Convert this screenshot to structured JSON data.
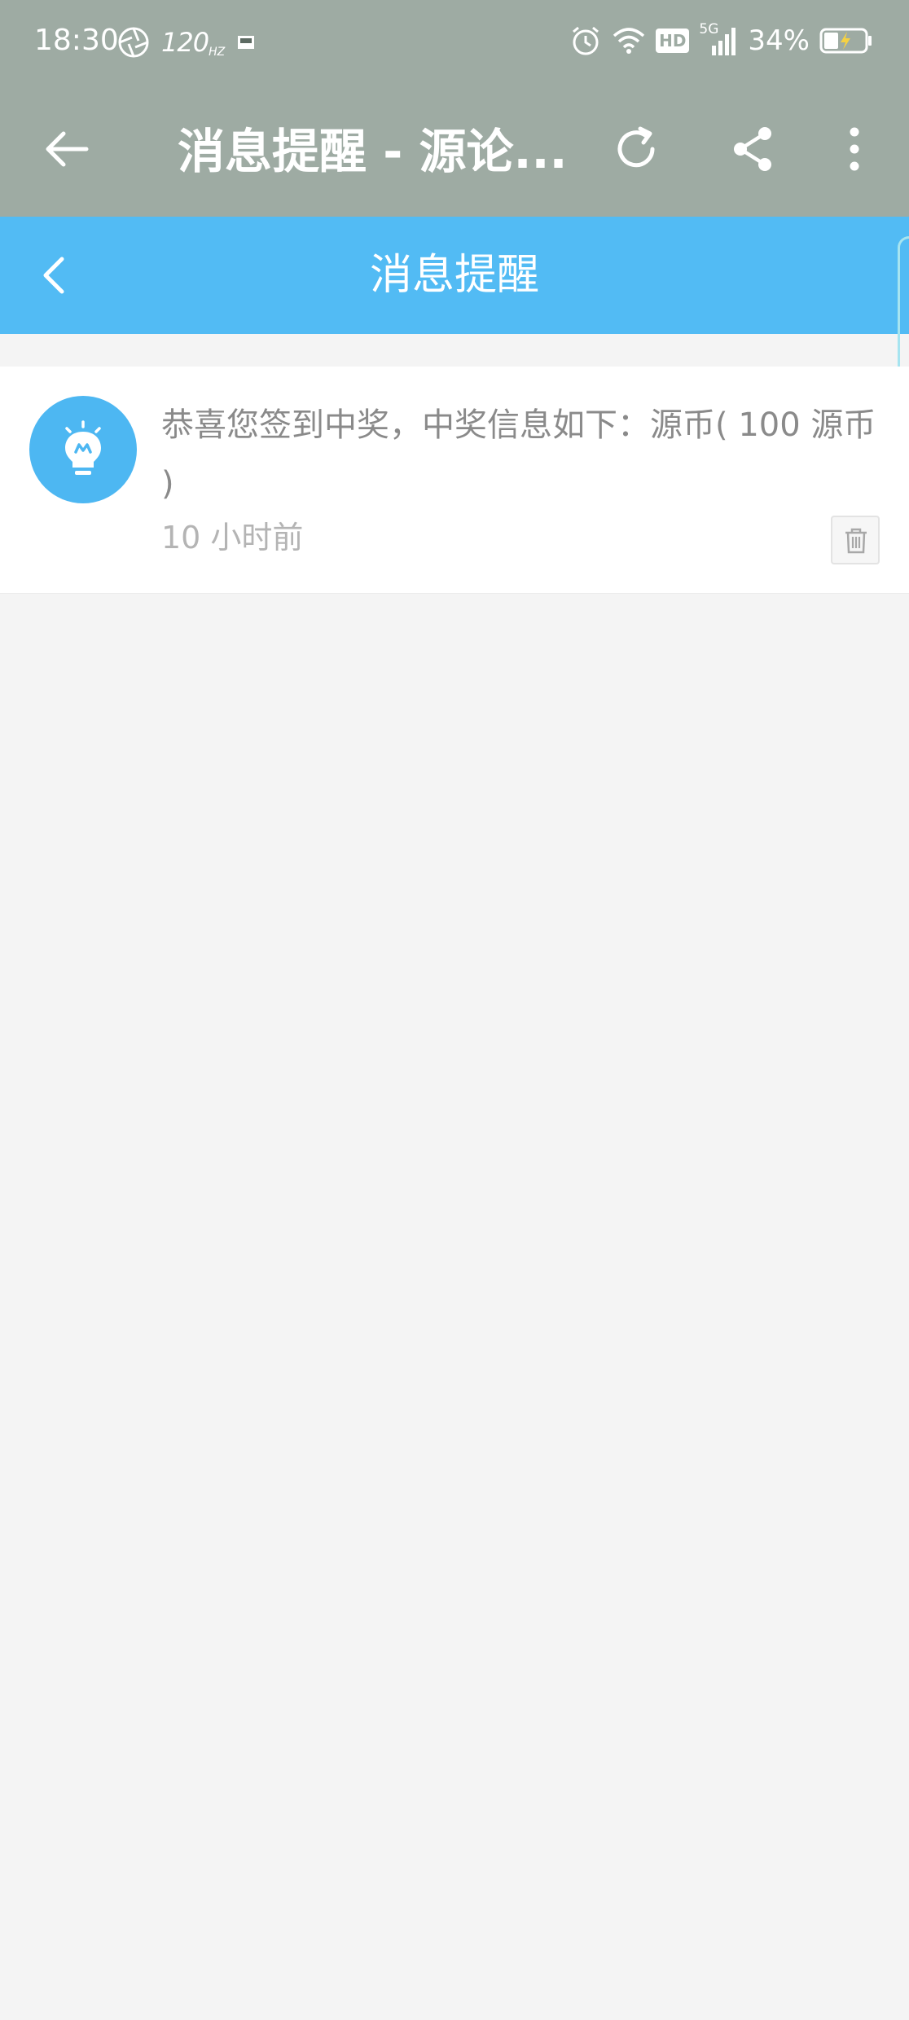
{
  "status_bar": {
    "time": "18:30",
    "refresh_rate": "120",
    "refresh_unit": "HZ",
    "network": "5G",
    "hd_badge": "HD",
    "battery": "34%",
    "icons": [
      "aperture-icon",
      "sim-icon",
      "alarm-icon",
      "wifi-icon",
      "hd-icon",
      "signal-icon",
      "battery-charging-icon"
    ]
  },
  "app_bar": {
    "title": "消息提醒 - 源论...",
    "icons": [
      "back-arrow-icon",
      "refresh-icon",
      "share-icon",
      "more-vertical-icon"
    ]
  },
  "page_header": {
    "title": "消息提醒",
    "back_icon": "chevron-left-icon"
  },
  "messages": [
    {
      "avatar_icon": "lightbulb-icon",
      "text": "恭喜您签到中奖，中奖信息如下：源币( 100 源币 )",
      "time": "10 小时前",
      "delete_icon": "trash-icon"
    }
  ],
  "colors": {
    "top_bar": "#9eaba3",
    "header_blue": "#52bbf4",
    "avatar_blue": "#4db7f2",
    "background": "#f4f4f4"
  }
}
